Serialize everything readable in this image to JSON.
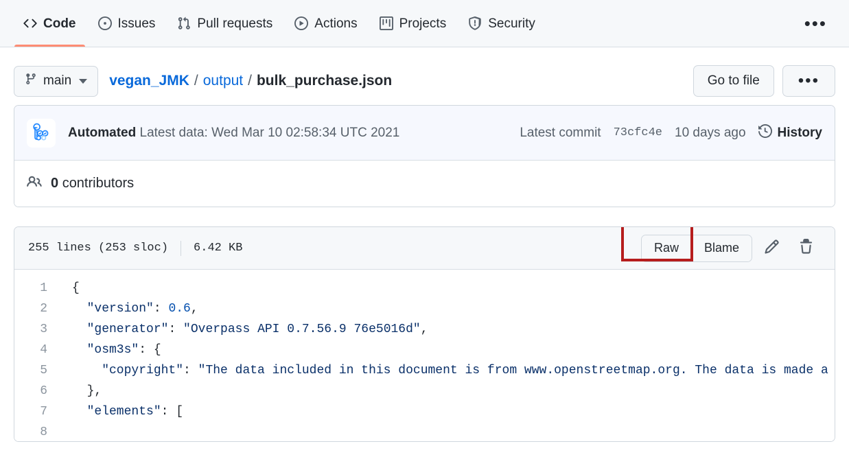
{
  "nav": {
    "tabs": [
      {
        "label": "Code",
        "icon": "code-icon",
        "active": true
      },
      {
        "label": "Issues",
        "icon": "issue-opened-icon",
        "active": false
      },
      {
        "label": "Pull requests",
        "icon": "git-pull-request-icon",
        "active": false
      },
      {
        "label": "Actions",
        "icon": "play-icon",
        "active": false
      },
      {
        "label": "Projects",
        "icon": "project-board-icon",
        "active": false
      },
      {
        "label": "Security",
        "icon": "shield-icon",
        "active": false
      }
    ],
    "overflow_label": "•••",
    "active_underline_color": "#fd8c73"
  },
  "file_header": {
    "branch": "main",
    "breadcrumb": {
      "repo": "vegan_JMK",
      "folder": "output",
      "file": "bulk_purchase.json",
      "separator": "/"
    },
    "go_to_file_label": "Go to file",
    "more_options_label": "•••"
  },
  "commit_info": {
    "author": "Automated",
    "message": "Latest data: Wed Mar 10 02:58:34 UTC 2021",
    "latest_commit_label": "Latest commit",
    "sha": "73cfc4e",
    "relative_time": "10 days ago",
    "history_label": "History"
  },
  "contributors": {
    "count": "0",
    "label": "contributors"
  },
  "file_toolbar": {
    "lines_text": "255 lines (253 sloc)",
    "size_text": "6.42 KB",
    "raw_label": "Raw",
    "blame_label": "Blame",
    "edit_icon": "pencil-icon",
    "delete_icon": "trash-icon",
    "highlight_color": "#b61d1d"
  },
  "code": {
    "language": "json",
    "line_numbers": [
      "1",
      "2",
      "3",
      "4",
      "5",
      "6",
      "7",
      "8"
    ],
    "lines": [
      {
        "n": "1",
        "tokens": [
          {
            "t": "punc",
            "v": "{"
          }
        ]
      },
      {
        "n": "2",
        "tokens": [
          {
            "t": "key",
            "v": "  \"version\""
          },
          {
            "t": "punc",
            "v": ": "
          },
          {
            "t": "num",
            "v": "0.6"
          },
          {
            "t": "punc",
            "v": ","
          }
        ]
      },
      {
        "n": "3",
        "tokens": [
          {
            "t": "key",
            "v": "  \"generator\""
          },
          {
            "t": "punc",
            "v": ": "
          },
          {
            "t": "str",
            "v": "\"Overpass API 0.7.56.9 76e5016d\""
          },
          {
            "t": "punc",
            "v": ","
          }
        ]
      },
      {
        "n": "4",
        "tokens": [
          {
            "t": "key",
            "v": "  \"osm3s\""
          },
          {
            "t": "punc",
            "v": ": {"
          }
        ]
      },
      {
        "n": "5",
        "tokens": [
          {
            "t": "key",
            "v": "    \"copyright\""
          },
          {
            "t": "punc",
            "v": ": "
          },
          {
            "t": "str",
            "v": "\"The data included in this document is from www.openstreetmap.org. The data is made a"
          }
        ]
      },
      {
        "n": "6",
        "tokens": [
          {
            "t": "punc",
            "v": "  },"
          }
        ]
      },
      {
        "n": "7",
        "tokens": [
          {
            "t": "key",
            "v": "  \"elements\""
          },
          {
            "t": "punc",
            "v": ": ["
          }
        ]
      },
      {
        "n": "8",
        "tokens": [
          {
            "t": "punc",
            "v": ""
          }
        ]
      }
    ]
  },
  "colors": {
    "accent_blue": "#0969da",
    "header_bg": "#f6f8fa",
    "border": "#d0d7de",
    "commit_bar_bg": "#f6f8fe",
    "json_key": "#0a3069",
    "json_number": "#0550ae",
    "muted_text": "#57606a"
  }
}
